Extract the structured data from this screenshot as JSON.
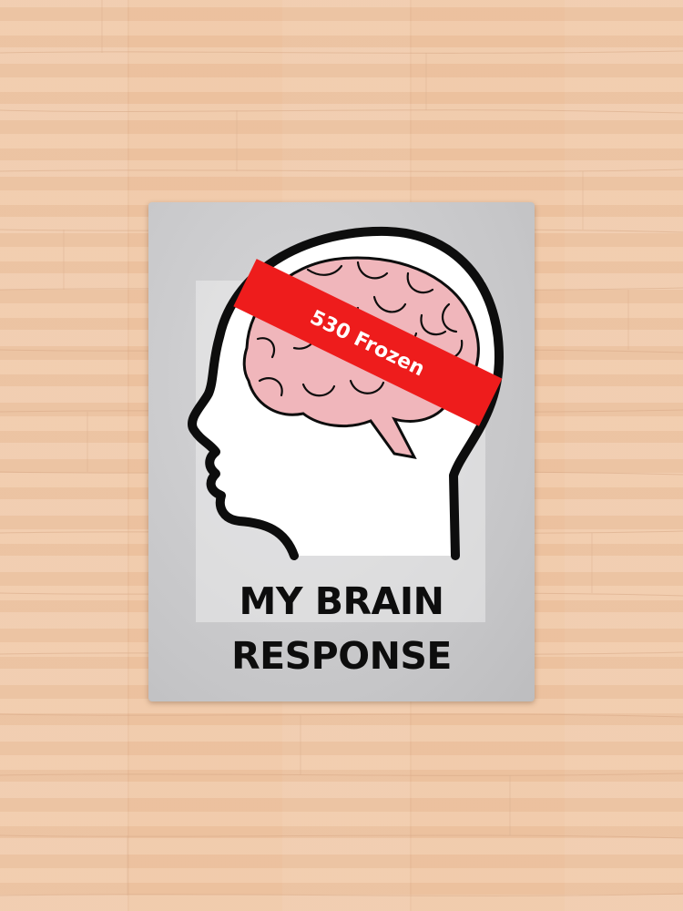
{
  "product": {
    "band_text": "530  Frozen",
    "caption_line_1": "MY BRAIN",
    "caption_line_2": "RESPONSE"
  },
  "colors": {
    "band": "#ee1c1c",
    "brain": "#f0b6bb",
    "outline": "#0d0d0d",
    "blanket": "#c9c9cb",
    "floor": "#efc6a4"
  }
}
